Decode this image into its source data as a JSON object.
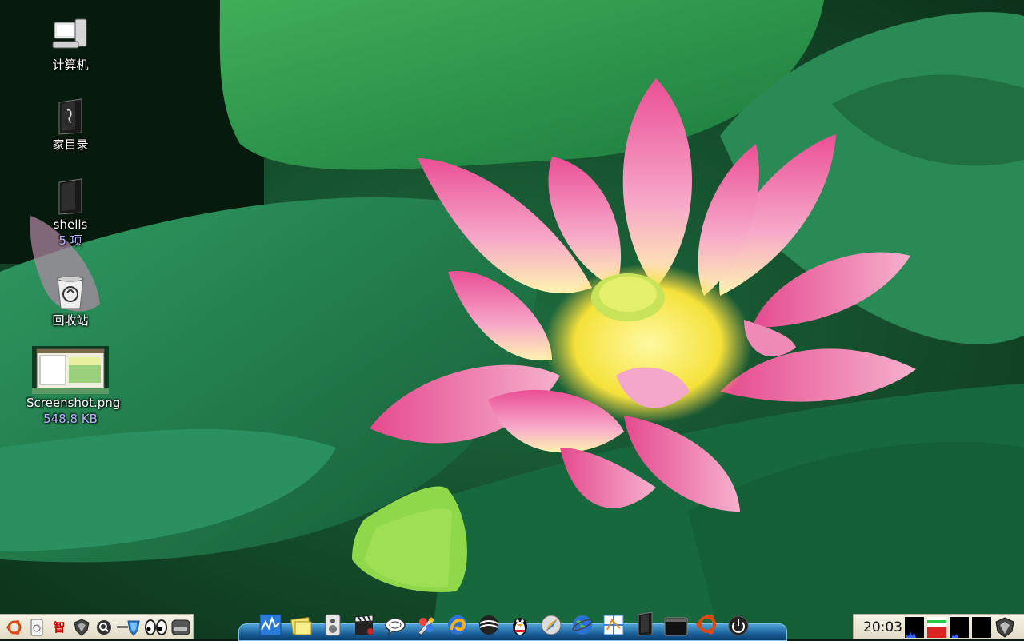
{
  "desktop": {
    "icons": [
      {
        "label": "计算机",
        "sub": ""
      },
      {
        "label": "家目录",
        "sub": ""
      },
      {
        "label": "shells",
        "sub": "5 项"
      },
      {
        "label": "回收站",
        "sub": ""
      },
      {
        "label": "Screenshot.png",
        "sub": "548.8 KB"
      }
    ]
  },
  "left_panel": {
    "items": [
      "ubuntu-logo-icon",
      "document-icon",
      "zhi-input-icon",
      "shield-icon",
      "magnifier-icon",
      "network-icon",
      "eyes-icon",
      "drive-icon"
    ],
    "zhi_char": "智"
  },
  "dock": {
    "items": [
      "system-monitor-icon",
      "notes-icon",
      "speaker-icon",
      "clapperboard-icon",
      "chat-bubble-icon",
      "paint-palette-icon",
      "browser-swirl-icon",
      "globe-ball-icon",
      "qq-penguin-icon",
      "compass-icon",
      "earth-icon",
      "map-icon",
      "book-icon",
      "terminal-icon",
      "ubuntu-logo-icon",
      "power-icon"
    ]
  },
  "tray": {
    "clock": "20:03",
    "colors": {
      "monitor_bg": "#000000",
      "green": "#22cc44",
      "red": "#dd2222",
      "blue": "#3366ff"
    }
  }
}
